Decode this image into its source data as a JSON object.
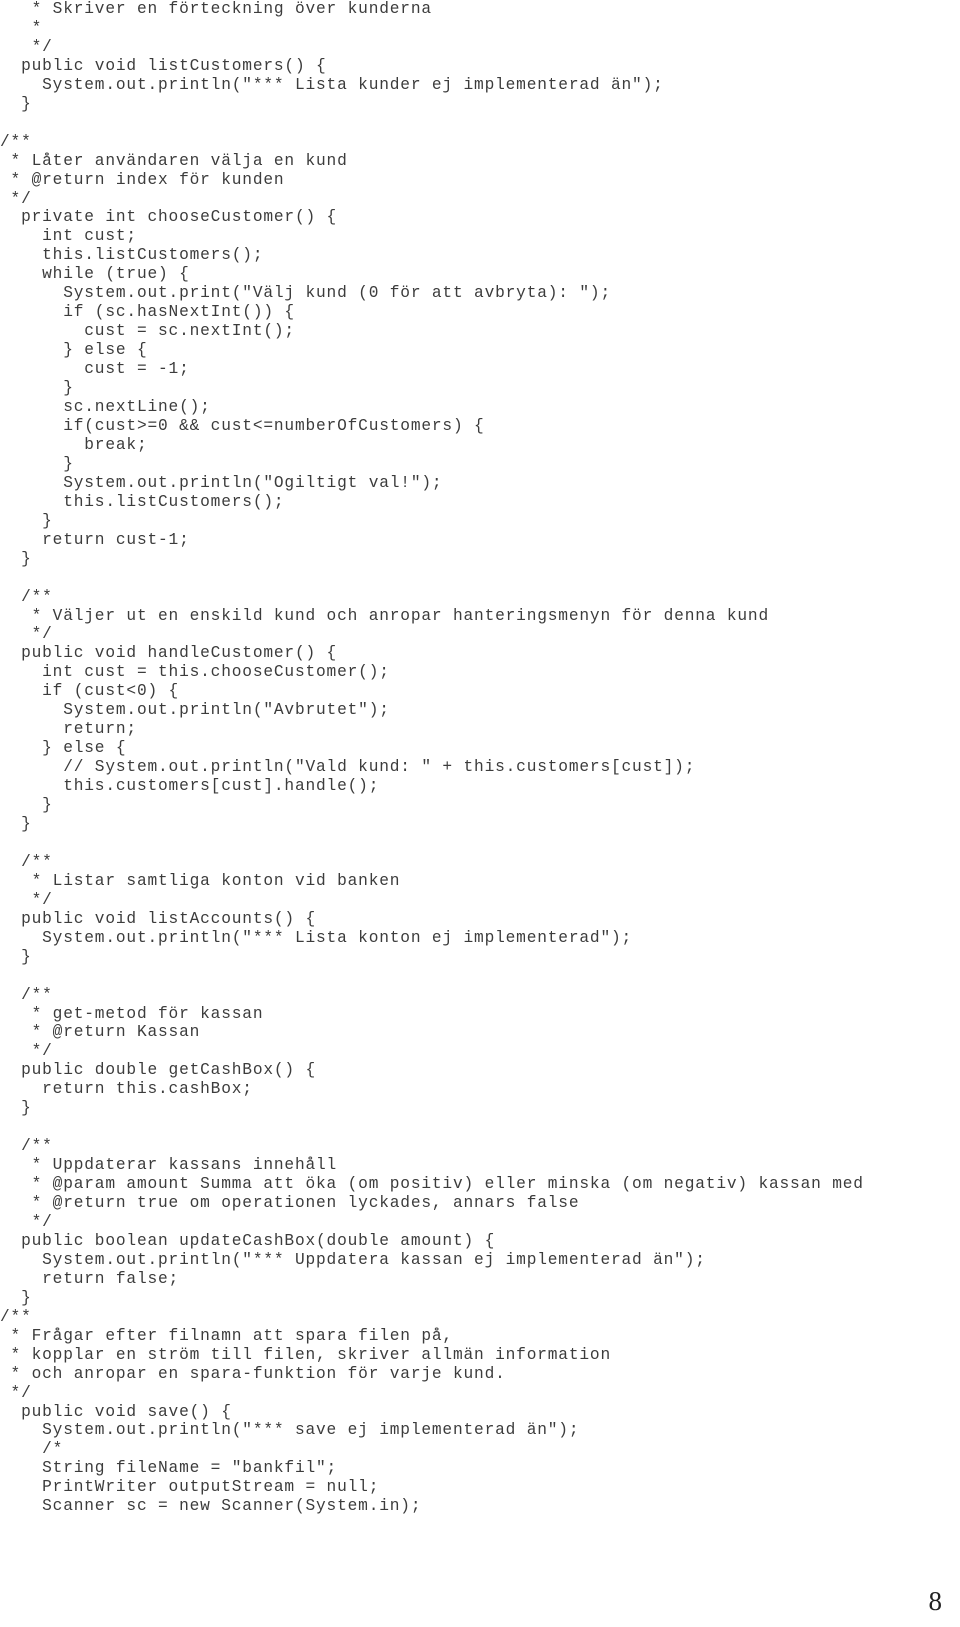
{
  "document": {
    "kind": "source-code-listing",
    "language": "Java",
    "page_number": "8",
    "text_color": "#3c3c3c",
    "background_color": "#ffffff",
    "code_lines": [
      "   * Skriver en förteckning över kunderna",
      "   *",
      "   */",
      "  public void listCustomers() {",
      "    System.out.println(\"*** Lista kunder ej implementerad än\");",
      "  }",
      "",
      "/**",
      " * Låter användaren välja en kund",
      " * @return index för kunden",
      " */",
      "  private int chooseCustomer() {",
      "    int cust;",
      "    this.listCustomers();",
      "    while (true) {",
      "      System.out.print(\"Välj kund (0 för att avbryta): \");",
      "      if (sc.hasNextInt()) {",
      "        cust = sc.nextInt();",
      "      } else {",
      "        cust = -1;",
      "      }",
      "      sc.nextLine();",
      "      if(cust>=0 && cust<=numberOfCustomers) {",
      "        break;",
      "      }",
      "      System.out.println(\"Ogiltigt val!\");",
      "      this.listCustomers();",
      "    }",
      "    return cust-1;",
      "  }",
      "",
      "  /**",
      "   * Väljer ut en enskild kund och anropar hanteringsmenyn för denna kund",
      "   */",
      "  public void handleCustomer() {",
      "    int cust = this.chooseCustomer();",
      "    if (cust<0) {",
      "      System.out.println(\"Avbrutet\");",
      "      return;",
      "    } else {",
      "      // System.out.println(\"Vald kund: \" + this.customers[cust]);",
      "      this.customers[cust].handle();",
      "    }",
      "  }",
      "",
      "  /**",
      "   * Listar samtliga konton vid banken",
      "   */",
      "  public void listAccounts() {",
      "    System.out.println(\"*** Lista konton ej implementerad\");",
      "  }",
      "",
      "  /**",
      "   * get-metod för kassan",
      "   * @return Kassan",
      "   */",
      "  public double getCashBox() {",
      "    return this.cashBox;",
      "  }",
      "",
      "  /**",
      "   * Uppdaterar kassans innehåll",
      "   * @param amount Summa att öka (om positiv) eller minska (om negativ) kassan med",
      "   * @return true om operationen lyckades, annars false",
      "   */",
      "  public boolean updateCashBox(double amount) {",
      "    System.out.println(\"*** Uppdatera kassan ej implementerad än\");",
      "    return false;",
      "  }",
      "/**",
      " * Frågar efter filnamn att spara filen på,",
      " * kopplar en ström till filen, skriver allmän information",
      " * och anropar en spara-funktion för varje kund.",
      " */",
      "  public void save() {",
      "    System.out.println(\"*** save ej implementerad än\");",
      "    /*",
      "    String fileName = \"bankfil\";",
      "    PrintWriter outputStream = null;",
      "    Scanner sc = new Scanner(System.in);"
    ]
  }
}
